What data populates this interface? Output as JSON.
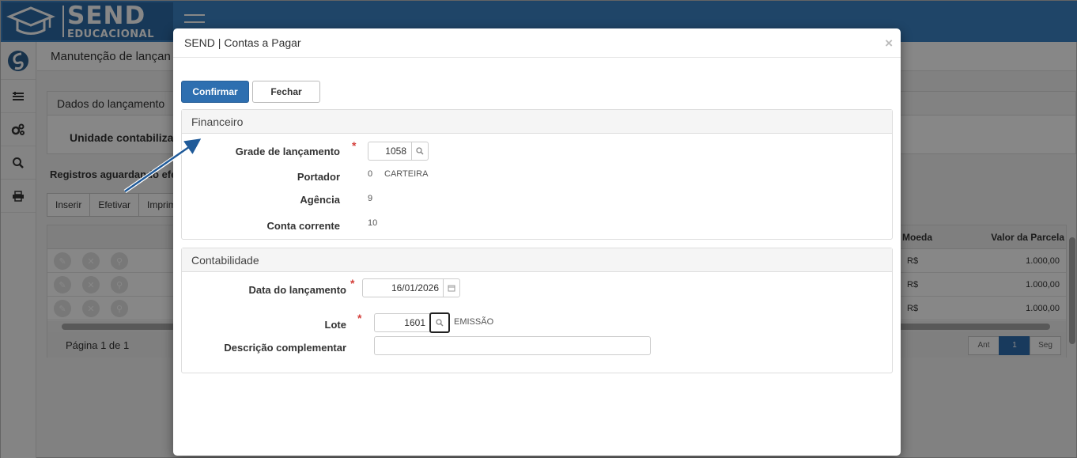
{
  "app": {
    "logo_line1": "SEND",
    "logo_line2": "EDUCACIONAL",
    "page_title": "Manutenção de lançan",
    "panel_title": "Dados do lançamento",
    "panel_field": "Unidade contabiliza",
    "registros_title": "Registros aguardando efe",
    "buttons": [
      "Inserir",
      "Efetivar",
      "Imprim"
    ],
    "grid": {
      "col_moeda": "Moeda",
      "col_valor": "Valor da Parcela",
      "rows": [
        {
          "moeda": "R$",
          "valor": "1.000,00"
        },
        {
          "moeda": "R$",
          "valor": "1.000,00"
        },
        {
          "moeda": "R$",
          "valor": "1.000,00"
        }
      ],
      "pagination_text": "Página 1 de 1",
      "pager": {
        "prev": "Ant",
        "current": "1",
        "next": "Seg"
      }
    },
    "sidebar_icons": [
      "send-logo-icon",
      "list-icon",
      "gears-icon",
      "search-icon",
      "print-icon"
    ]
  },
  "modal": {
    "title": "SEND | Contas a Pagar",
    "close": "×",
    "confirm_label": "Confirmar",
    "close_label": "Fechar",
    "financeiro": {
      "title": "Financeiro",
      "grade_label": "Grade de lançamento",
      "grade_value": "1058",
      "portador_label": "Portador",
      "portador_code": "0",
      "portador_name": "CARTEIRA",
      "agencia_label": "Agência",
      "agencia_value": "9",
      "conta_label": "Conta corrente",
      "conta_value": "10"
    },
    "contabilidade": {
      "title": "Contabilidade",
      "data_label": "Data do lançamento",
      "data_value": "16/01/2026",
      "lote_label": "Lote",
      "lote_value": "1601",
      "lote_desc": "EMISSÃO",
      "descricao_label": "Descrição complementar",
      "descricao_value": ""
    },
    "required_mark": "*"
  },
  "colors": {
    "brand_blue": "#3b82c4",
    "primary_button": "#2e6fb0",
    "required": "#d43f3a",
    "arrow": "#1f5a99"
  }
}
